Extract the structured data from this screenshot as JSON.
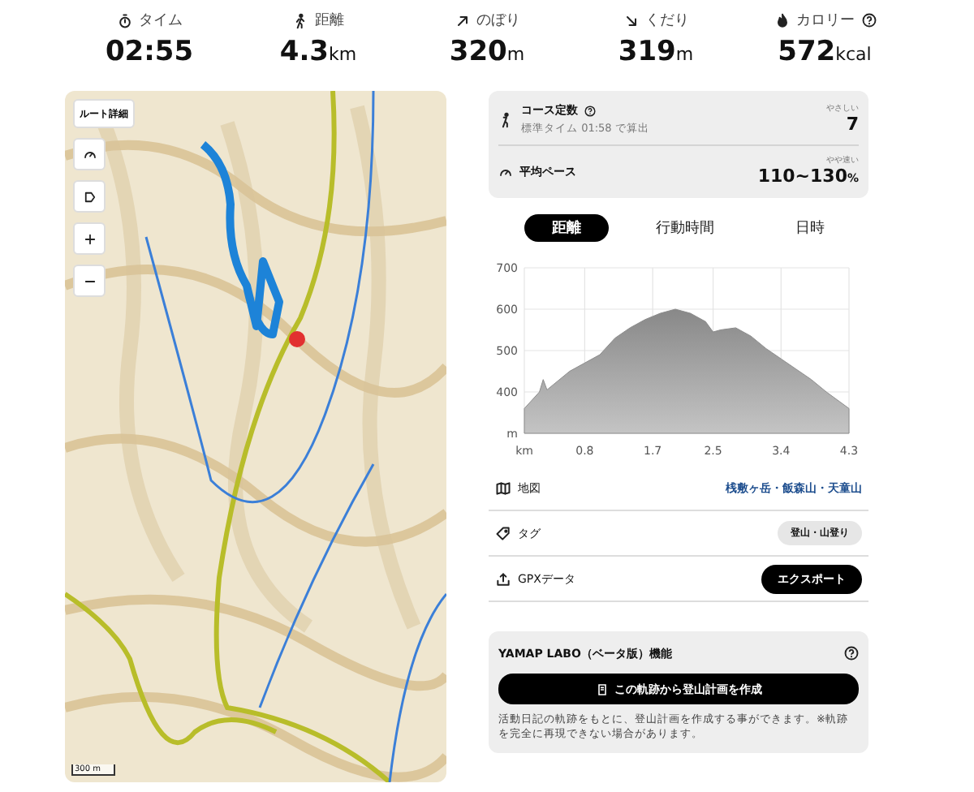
{
  "stats": [
    {
      "label": "タイム",
      "value": "02:55",
      "help": false
    },
    {
      "label": "距離",
      "value": "4.3",
      "unit": "km",
      "help": false
    },
    {
      "label": "のぼり",
      "value": "320",
      "unit": "m",
      "help": false
    },
    {
      "label": "くだり",
      "value": "319",
      "unit": "m",
      "help": false
    },
    {
      "label": "カロリー",
      "value": "572",
      "unit": "kcal",
      "help": true
    }
  ],
  "map": {
    "controls": [
      {
        "kind": "text",
        "label": "ルート詳細"
      },
      {
        "kind": "gauge"
      },
      {
        "kind": "layer"
      },
      {
        "kind": "zoom-in"
      },
      {
        "kind": "zoom-out"
      }
    ],
    "scale": "300 m"
  },
  "course": {
    "title": "コース定数",
    "subtitle": "標準タイム 01:58 で算出",
    "grade": "やさしい",
    "value": "7"
  },
  "pace": {
    "title": "平均ペース",
    "grade": "やや速い",
    "value": "110~130",
    "unit": "%"
  },
  "tabs": [
    {
      "label": "距離",
      "selected": true
    },
    {
      "label": "行動時間",
      "selected": false
    },
    {
      "label": "日時",
      "selected": false
    }
  ],
  "chart_data": {
    "type": "area",
    "x": [
      0,
      0.2,
      0.25,
      0.3,
      0.6,
      0.8,
      1.0,
      1.2,
      1.4,
      1.6,
      1.8,
      2.0,
      2.2,
      2.4,
      2.5,
      2.6,
      2.8,
      3.0,
      3.2,
      3.4,
      3.6,
      3.8,
      4.0,
      4.3
    ],
    "grid": true,
    "series": [
      {
        "color": "#8c8c8c",
        "values": [
          360,
          400,
          430,
          405,
          450,
          470,
          490,
          530,
          555,
          575,
          590,
          600,
          590,
          570,
          545,
          550,
          555,
          535,
          505,
          480,
          455,
          430,
          400,
          360
        ]
      }
    ],
    "xlim": [
      0,
      4.3
    ],
    "ylim": [
      300,
      700
    ],
    "xticks": [
      {
        "value": 0,
        "label": "km"
      },
      0.8,
      1.7,
      2.5,
      3.4,
      4.3
    ],
    "yticks": [
      {
        "value": 300,
        "label": "m"
      },
      400,
      500,
      600,
      700
    ]
  },
  "info": [
    {
      "kind": "link",
      "label": "地図",
      "value": "桟敷ヶ岳・飯森山・天童山"
    },
    {
      "kind": "tag",
      "label": "タグ",
      "value": "登山・山登り"
    },
    {
      "kind": "button",
      "label": "GPXデータ",
      "value": "エクスポート"
    }
  ],
  "labo": {
    "title": "YAMAP LABO（ベータ版）機能",
    "button": "この軌跡から登山計画を作成",
    "note": "活動日記の軌跡をもとに、登山計画を作成する事ができます。※軌跡を完全に再現できない場合があります。"
  }
}
